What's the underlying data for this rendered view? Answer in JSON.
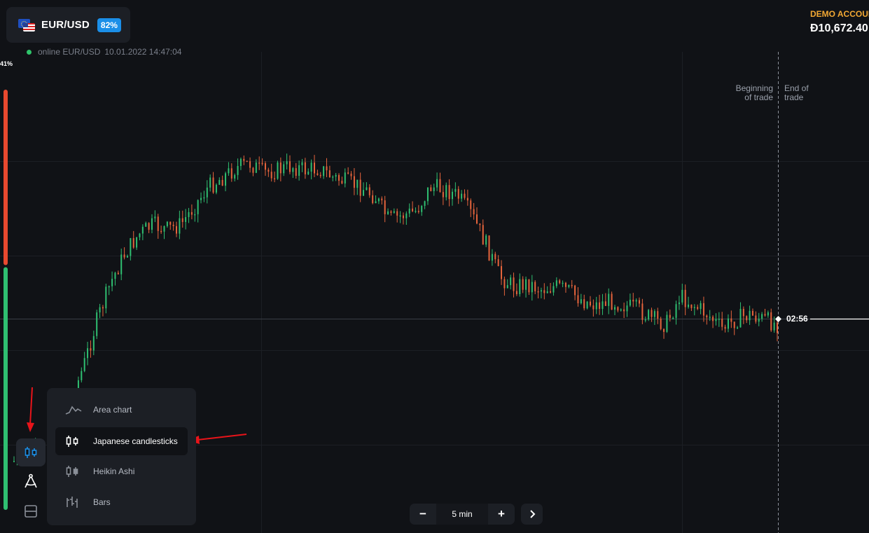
{
  "asset": {
    "name": "EUR/USD",
    "payout": "82%"
  },
  "status": {
    "text": "online EUR/USD",
    "datetime": "10.01.2022 14:47:04"
  },
  "sentiment": {
    "label": "41%",
    "up_fraction": 0.58
  },
  "account": {
    "label": "DEMO ACCOUNT",
    "balance": "Đ10,672.40"
  },
  "trade_markers": {
    "beginning": [
      "Beginning",
      "of trade"
    ],
    "end": [
      "End of",
      "trade"
    ]
  },
  "timer": "02:56",
  "chart_type_menu": {
    "items": [
      {
        "label": "Area chart",
        "icon": "area-chart-icon"
      },
      {
        "label": "Japanese candlesticks",
        "icon": "candlestick-icon",
        "selected": true
      },
      {
        "label": "Heikin Ashi",
        "icon": "heikin-ashi-icon"
      },
      {
        "label": "Bars",
        "icon": "bars-icon"
      }
    ]
  },
  "tools": [
    {
      "name": "candlestick-tool",
      "icon": "candlestick-icon",
      "active": true
    },
    {
      "name": "drawing-tool",
      "icon": "compass-icon"
    },
    {
      "name": "layout-tool",
      "icon": "split-layout-icon"
    }
  ],
  "timeframe": {
    "minus": "−",
    "value": "5 min",
    "plus": "+"
  },
  "colors": {
    "background": "#101216",
    "up_candle": "#2fbf71",
    "down_candle": "#e6643c",
    "sentiment_down": "#e8492f",
    "sentiment_up": "#2fbf71",
    "account_label": "#f2a833",
    "badge": "#1b8fe8",
    "active_icon": "#1b8fe8",
    "annotation_arrow": "#e8141a"
  },
  "chart_data": {
    "type": "candlestick",
    "trend": [
      0.9,
      0.95,
      1.0,
      1.2,
      1.5,
      1.9,
      2.4,
      2.8,
      3.1,
      3.3,
      3.4,
      3.35,
      3.4,
      3.6,
      3.8,
      3.9,
      4.0,
      4.05,
      3.95,
      3.98,
      4.02,
      3.98,
      4.0,
      3.9,
      3.85,
      3.8,
      3.7,
      3.45,
      3.5,
      3.55,
      3.8,
      3.78,
      3.7,
      3.5,
      3.2,
      2.85,
      2.75,
      2.78,
      2.72,
      2.75,
      2.7,
      2.6,
      2.55,
      2.6,
      2.55,
      2.5,
      2.4,
      2.35,
      2.65,
      2.55,
      2.45,
      2.3,
      2.4,
      2.45,
      2.4,
      2.35
    ]
  }
}
